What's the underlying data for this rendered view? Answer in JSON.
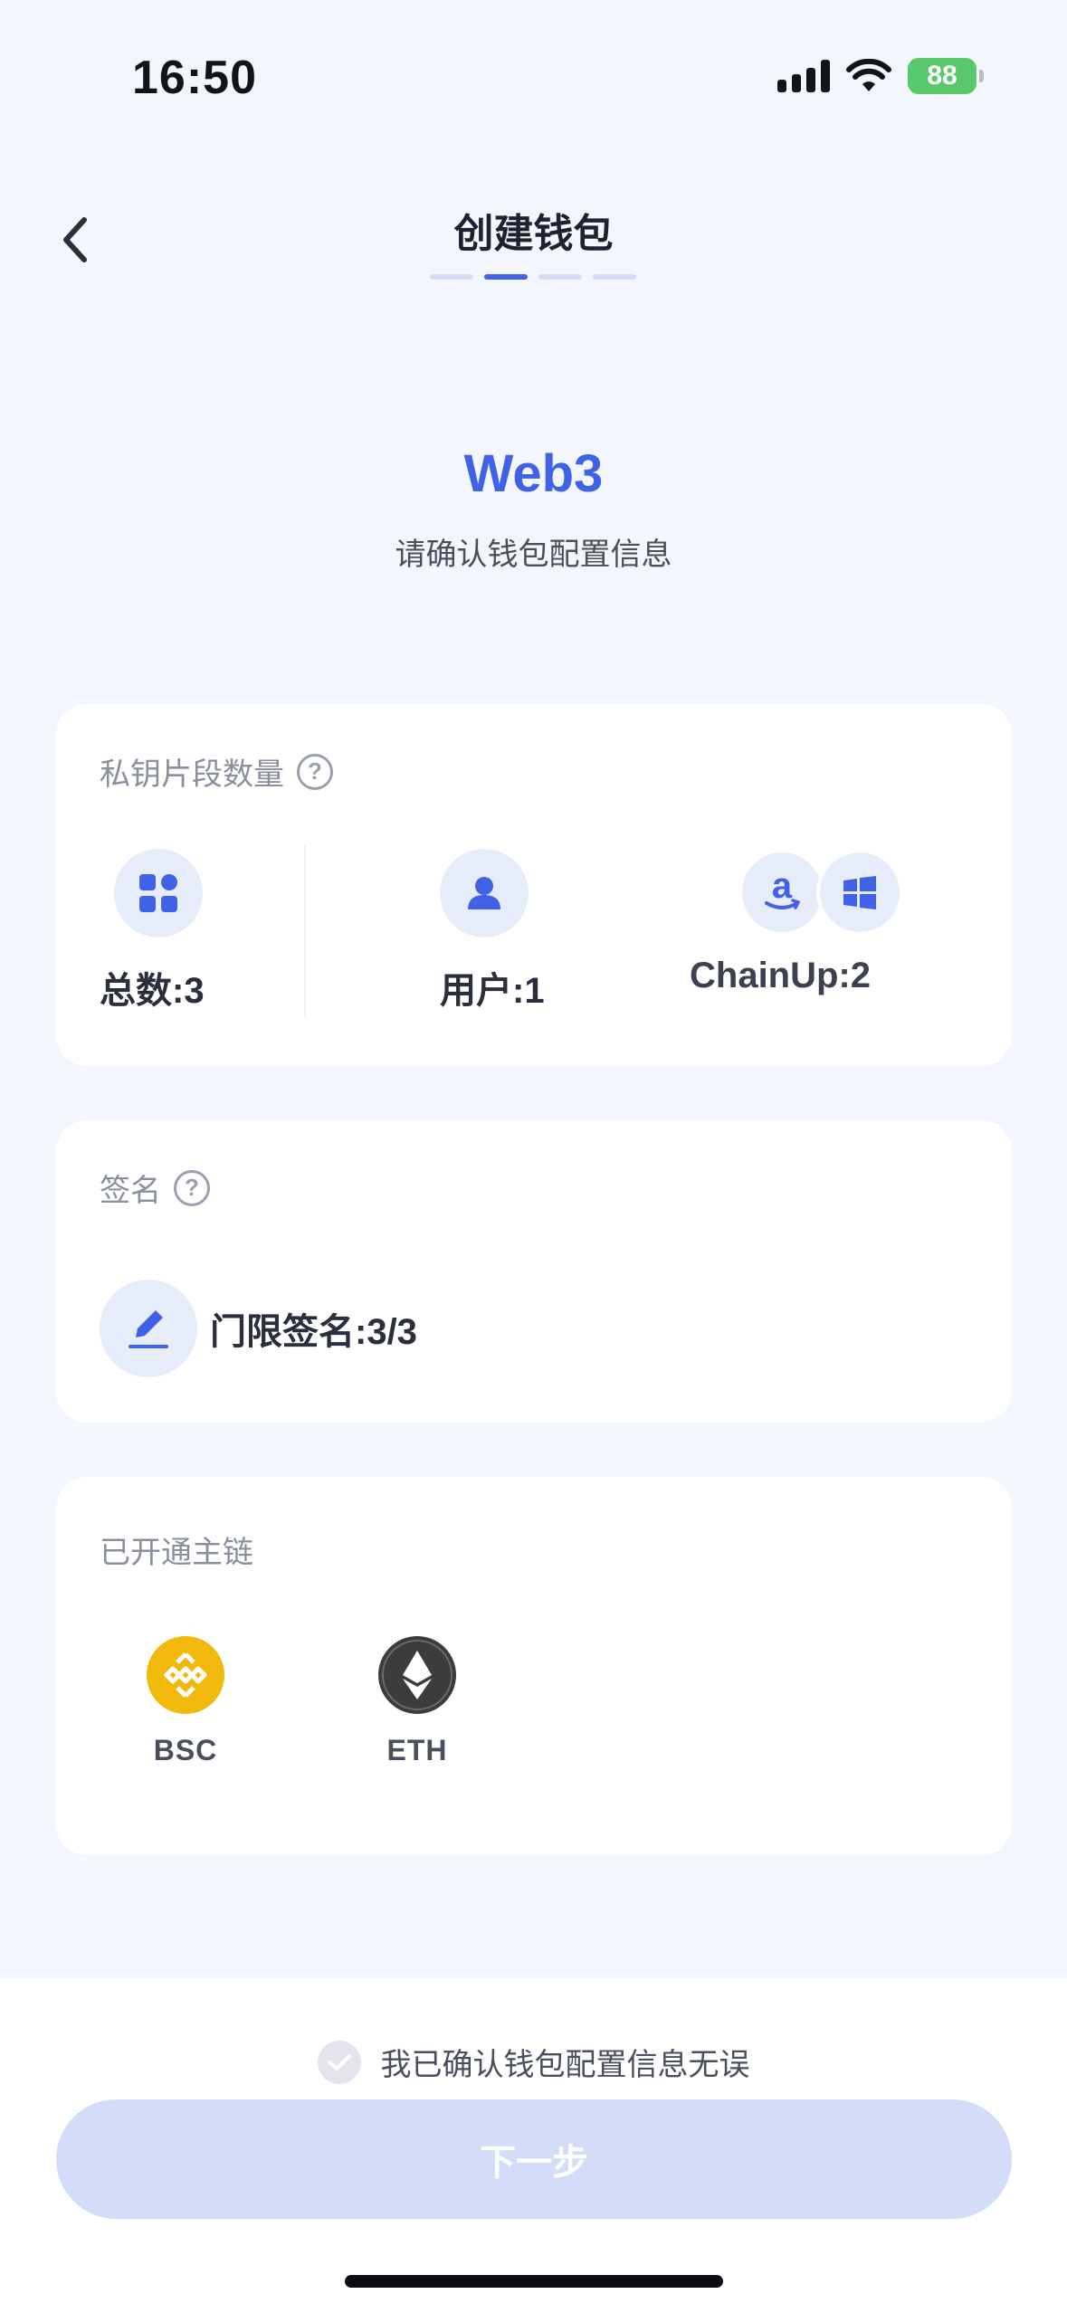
{
  "status_bar": {
    "time": "16:50",
    "battery": "88"
  },
  "nav": {
    "title": "创建钱包",
    "steps_total": 4,
    "active_step": 2
  },
  "hero": {
    "title": "Web3",
    "subtitle": "请确认钱包配置信息"
  },
  "key_fragments": {
    "title": "私钥片段数量",
    "total_label": "总数:3",
    "user_label": "用户:1",
    "chainup_label": "ChainUp:2"
  },
  "signature": {
    "title": "签名",
    "threshold_label": "门限签名:3/3"
  },
  "chains": {
    "title": "已开通主链",
    "items": [
      {
        "label": "BSC",
        "color": "#f0b90b"
      },
      {
        "label": "ETH",
        "color": "#3c3c3d"
      }
    ]
  },
  "footer": {
    "confirm_text": "我已确认钱包配置信息无误",
    "next_label": "下一步"
  },
  "colors": {
    "accent": "#3f62e6",
    "background": "#f3f6fd",
    "button_disabled": "#d3ddf9"
  }
}
